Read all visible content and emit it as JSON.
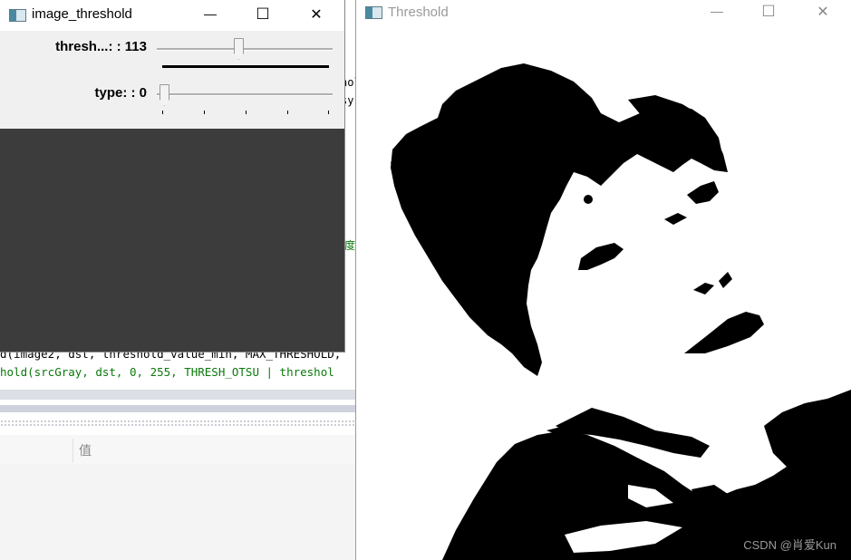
{
  "ide": {
    "code_lines": [
      {
        "text": "d(image2, dst, threshold_value_min, MAX_THRESHOLD,",
        "color": "#000000"
      },
      {
        "text": "hold(srcGray, dst, 0, 255, THRESH_OTSU | threshol",
        "color": "#0a7a0a"
      },
      {
        "text": "                                                  ",
        "color": "#000000"
      }
    ],
    "fragments": {
      "frag1": "hol",
      "frag2": "syr",
      "frag3": "度"
    },
    "grid_header_label": "值"
  },
  "control_window": {
    "title": "image_threshold",
    "buttons": {
      "minimize": "—",
      "maximize": "☐",
      "close": "✕"
    },
    "trackbars": [
      {
        "label": "thresh...: : 113",
        "value": 113,
        "max": 255
      },
      {
        "label": "type: : 0",
        "value": 0,
        "max": 4
      }
    ]
  },
  "threshold_window": {
    "title": "Threshold",
    "buttons": {
      "minimize": "—",
      "maximize": "☐",
      "close": "✕"
    },
    "watermark": "CSDN @肖爱Kun"
  }
}
